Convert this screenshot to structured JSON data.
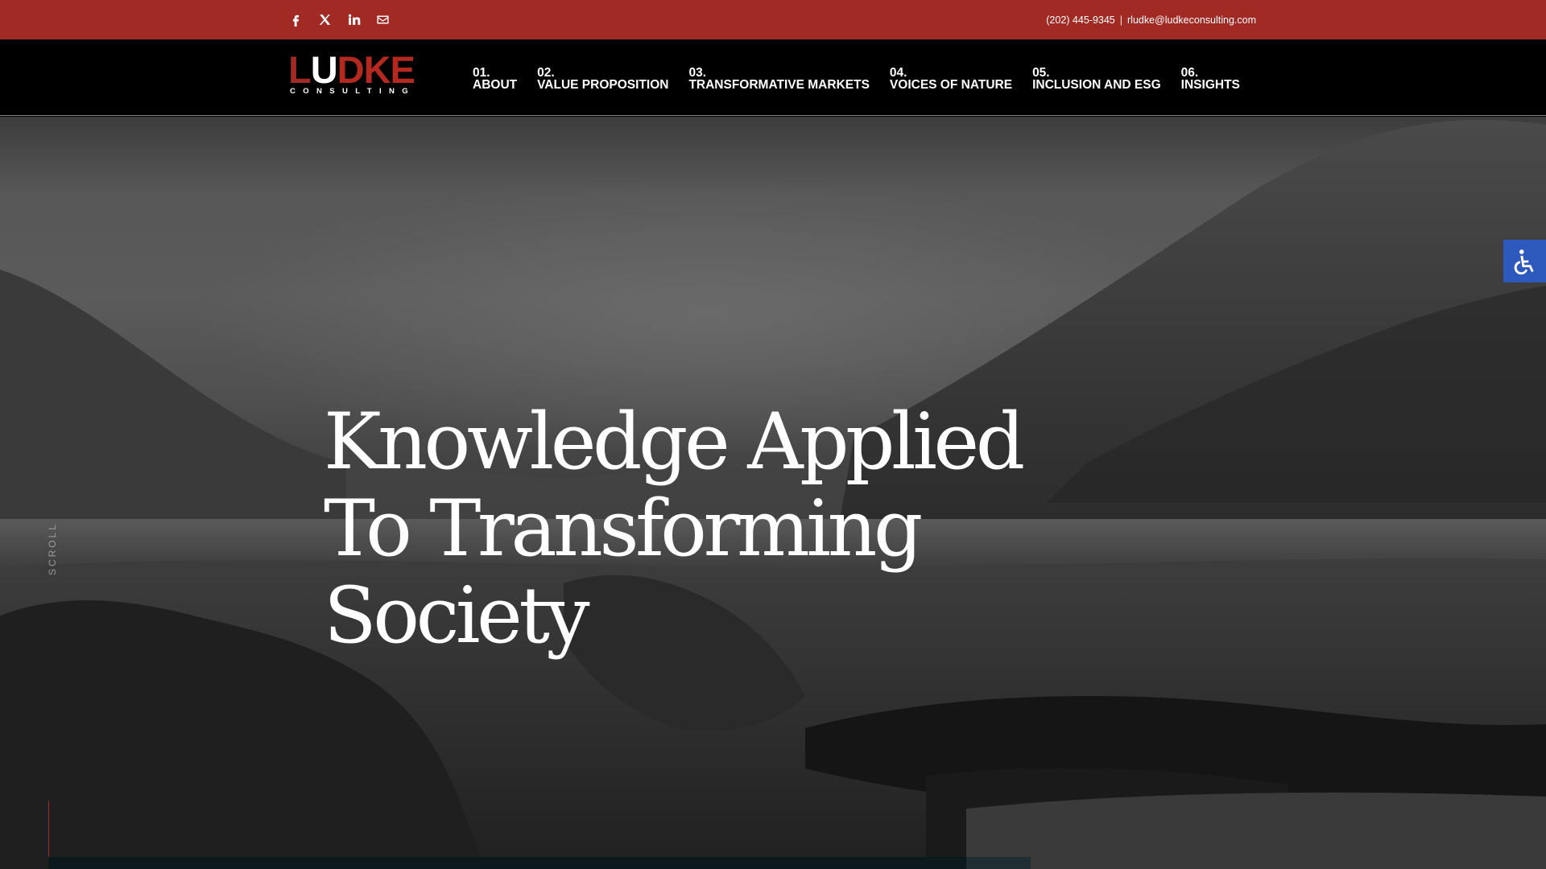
{
  "topbar": {
    "social": [
      {
        "name": "facebook-icon"
      },
      {
        "name": "x-twitter-icon"
      },
      {
        "name": "linkedin-icon"
      },
      {
        "name": "email-icon"
      }
    ],
    "phone": "(202) 445-9345",
    "separator": "|",
    "email": "rludke@ludkeconsulting.com"
  },
  "logo": {
    "word_a": "LU",
    "word_b": "DKE",
    "sub": "CONSULTING"
  },
  "nav": {
    "items": [
      {
        "num": "01.",
        "label": "ABOUT"
      },
      {
        "num": "02.",
        "label": "VALUE PROPOSITION"
      },
      {
        "num": "03.",
        "label": "TRANSFORMATIVE MARKETS"
      },
      {
        "num": "04.",
        "label": "VOICES OF NATURE"
      },
      {
        "num": "05.",
        "label": "INCLUSION AND ESG"
      },
      {
        "num": "06.",
        "label": "INSIGHTS"
      }
    ]
  },
  "hero": {
    "headline_lines": [
      "Knowledge Applied",
      "To Transforming",
      "Society"
    ],
    "scroll_label": "SCROLL"
  },
  "colors": {
    "accent": "#a12a24",
    "accessibility": "#2e59bc"
  }
}
